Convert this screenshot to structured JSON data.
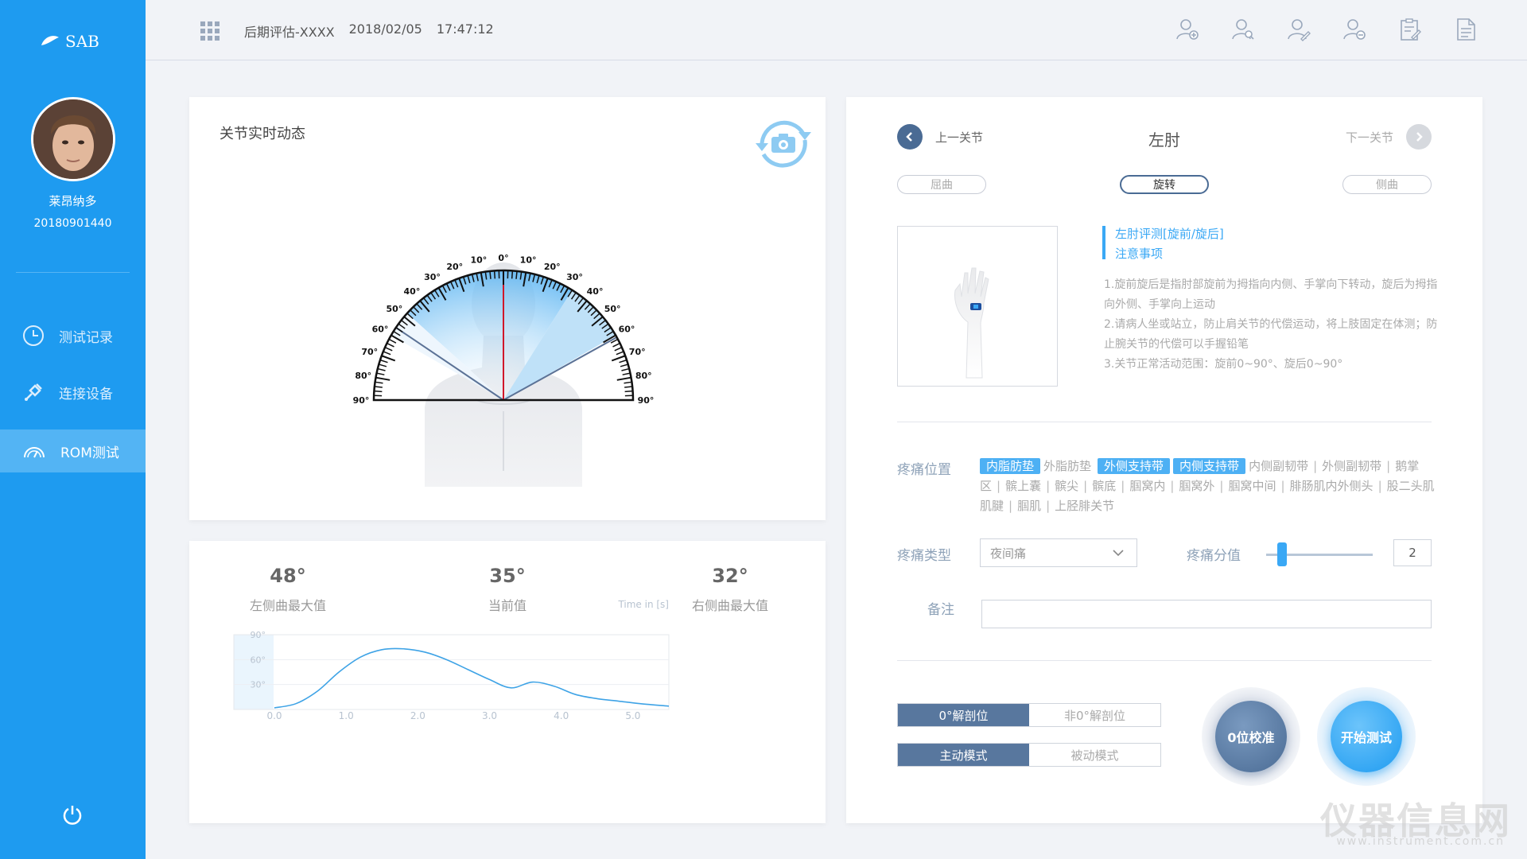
{
  "app": {
    "brand": "SAB"
  },
  "user": {
    "name": "莱昂纳多",
    "id": "20180901440"
  },
  "sidebar": {
    "items": [
      {
        "label": "测试记录",
        "icon": "clock-icon"
      },
      {
        "label": "连接设备",
        "icon": "plug-icon"
      },
      {
        "label": "ROM测试",
        "icon": "gauge-icon",
        "active": true
      }
    ]
  },
  "header": {
    "title": "后期评估-XXXX",
    "date": "2018/02/05",
    "time": "17:47:12"
  },
  "joint_panel": {
    "title": "关节实时动态",
    "left_ticks": [
      "90°",
      "80°",
      "70°",
      "60°",
      "50°",
      "40°",
      "30°",
      "20°",
      "10°"
    ],
    "center_tick": "0°",
    "right_ticks": [
      "10°",
      "20°",
      "30°",
      "40°",
      "50°",
      "60°",
      "70°",
      "80°",
      "90°"
    ],
    "left_angle": 48,
    "right_angle": 32,
    "current_angle": 35
  },
  "stats": [
    {
      "value": "48°",
      "label": "左侧曲最大值"
    },
    {
      "value": "35°",
      "label": "当前值"
    },
    {
      "value": "32°",
      "label": "右侧曲最大值"
    }
  ],
  "chart_data": {
    "type": "line",
    "xlabel": "Time in [s]",
    "ylabel": "",
    "xlim": [
      0,
      5.5
    ],
    "ylim": [
      0,
      90
    ],
    "xticks": [
      "0.0",
      "1.0",
      "2.0",
      "3.0",
      "4.0",
      "5.0"
    ],
    "yticks": [
      "30°",
      "60°",
      "90°"
    ],
    "x": [
      0.0,
      0.3,
      0.6,
      0.9,
      1.2,
      1.5,
      1.8,
      2.1,
      2.4,
      2.7,
      3.0,
      3.3,
      3.6,
      3.9,
      4.2,
      4.5,
      4.8,
      5.1,
      5.5
    ],
    "y": [
      2,
      7,
      22,
      45,
      63,
      72,
      73,
      69,
      60,
      48,
      36,
      26,
      33,
      28,
      18,
      13,
      10,
      7,
      4
    ]
  },
  "right_panel": {
    "prev_label": "上一关节",
    "next_label": "下一关节",
    "joint": "左肘",
    "modes": [
      "屈曲",
      "旋转",
      "侧曲"
    ],
    "active_mode": "旋转",
    "note_title": "左肘评测[旋前/旋后]",
    "note_subtitle": "注意事项",
    "notes": [
      "1.旋前旋后是指肘部旋前为拇指向内侧、手掌向下转动，旋后为拇指向外侧、手掌向上运动",
      "2.请病人坐或站立，防止肩关节的代偿运动，将上肢固定在体测；防止腕关节的代偿可以手握铅笔",
      "3.关节正常活动范围：旋前0~90°、旋后0~90°"
    ],
    "pain_location_label": "疼痛位置",
    "pain_tags_selected": [
      "内脂肪垫",
      "外侧支持带",
      "内侧支持带"
    ],
    "pain_tags_other1": "外脂肪垫",
    "pain_tags_rest": [
      "内侧副韧带",
      "外侧副韧带",
      "鹅掌区",
      "髌上囊",
      "髌尖",
      "髌底",
      "腘窝内",
      "腘窝外",
      "腘窝中间",
      "腓肠肌内外侧头",
      "股二头肌肌腱",
      "腘肌",
      "上胫腓关节"
    ],
    "pain_type_label": "疼痛类型",
    "pain_type_value": "夜间痛",
    "pain_score_label": "疼痛分值",
    "pain_score_value": "2",
    "pain_score_fraction": 0.15,
    "remark_label": "备注",
    "anatomy_modes": [
      "0°解剖位",
      "非0°解剖位"
    ],
    "motion_modes": [
      "主动模式",
      "被动模式"
    ],
    "calibrate_label": "0位校准",
    "start_label": "开始测试"
  },
  "watermark": {
    "text": "仪器信息网",
    "url": "www.instrument.com.cn"
  },
  "colors": {
    "sidebar": "#1e9bf0",
    "accent": "#3aa8f5",
    "dark_seg": "#58779e"
  }
}
